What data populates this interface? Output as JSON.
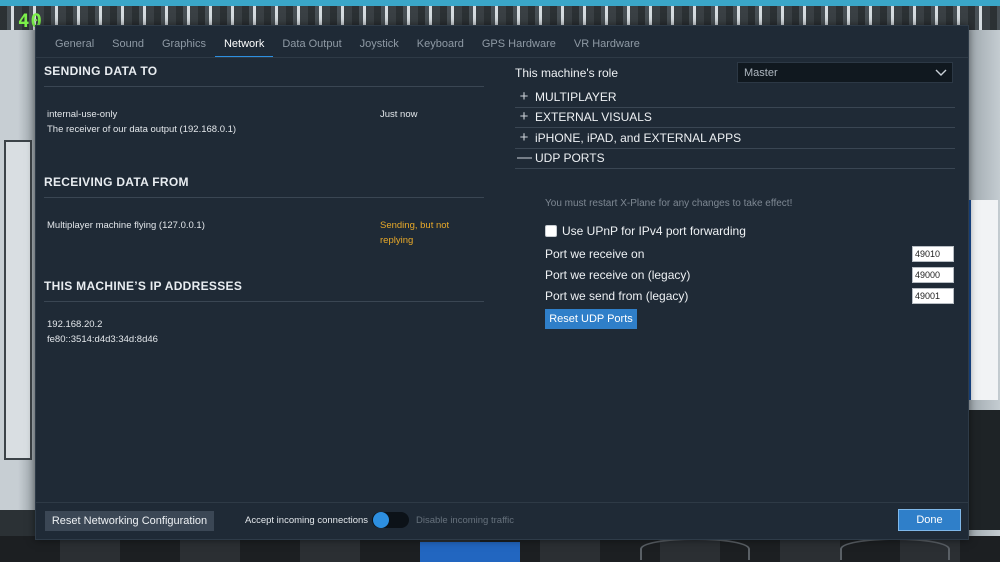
{
  "hud": {
    "fps": "40"
  },
  "tabs": [
    "General",
    "Sound",
    "Graphics",
    "Network",
    "Data Output",
    "Joystick",
    "Keyboard",
    "GPS Hardware",
    "VR Hardware"
  ],
  "active_tab": "Network",
  "sending": {
    "title": "SENDING DATA TO",
    "name": "internal-use-only",
    "time": "Just now",
    "desc": "The receiver of our data output (192.168.0.1)"
  },
  "receiving": {
    "title": "RECEIVING DATA FROM",
    "name": "Multiplayer machine flying  (127.0.0.1)",
    "status": "Sending, but not replying"
  },
  "ip": {
    "title": "THIS MACHINE’S IP ADDRESSES",
    "ipv4": "192.168.20.2",
    "ipv6": "fe80::3514:d4d3:34d:8d46"
  },
  "role": {
    "label": "This machine's role",
    "value": "Master"
  },
  "sections": {
    "multiplayer": "MULTIPLAYER",
    "external_visuals": "EXTERNAL VISUALS",
    "apps": "iPHONE, iPAD, and EXTERNAL APPS",
    "udp": "UDP PORTS"
  },
  "udp": {
    "note": "You must restart X-Plane for any changes to take effect!",
    "upnp_label": "Use UPnP for IPv4 port forwarding",
    "receive_label": "Port we receive on",
    "receive_value": "49010",
    "receive_legacy_label": "Port we receive on (legacy)",
    "receive_legacy_value": "49000",
    "send_legacy_label": "Port we send from (legacy)",
    "send_legacy_value": "49001",
    "reset_label": "Reset UDP Ports"
  },
  "footer": {
    "reset_label": "Reset Networking Configuration",
    "accept_label": "Accept incoming connections",
    "disable_label": "Disable incoming traffic",
    "done_label": "Done"
  },
  "colors": {
    "accent": "#2d8fe0",
    "warning": "#e8a92a",
    "panel": "#1f2a36"
  }
}
